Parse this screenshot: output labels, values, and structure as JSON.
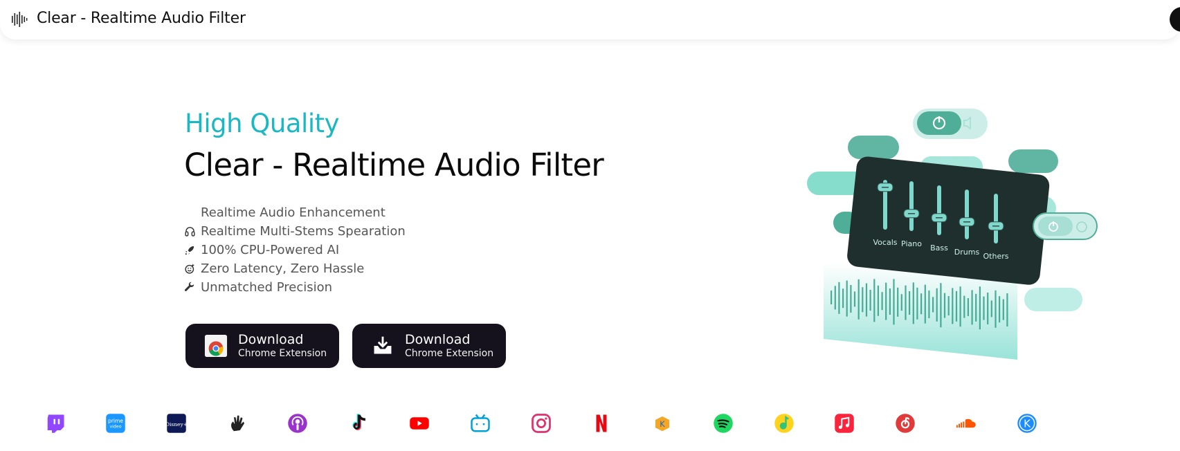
{
  "header": {
    "title": "Clear - Realtime Audio Filter",
    "logo_icon": "sound-bars-icon"
  },
  "hero": {
    "subtitle": "High Quality",
    "title": "Clear - Realtime Audio Filter",
    "accent_color": "#1bb8c3",
    "features": [
      {
        "icon": "sparkle-icon",
        "label": "Realtime Audio Enhancement"
      },
      {
        "icon": "headphones-icon",
        "label": "Realtime Multi-Stems Spearation"
      },
      {
        "icon": "rocket-icon",
        "label": "100% CPU-Powered AI"
      },
      {
        "icon": "smile-icon",
        "label": "Zero Latency, Zero Hassle"
      },
      {
        "icon": "wrench-icon",
        "label": "Unmatched Precision"
      }
    ],
    "buttons": [
      {
        "icon": "chrome-icon",
        "line1": "Download",
        "line2": "Chrome Extension"
      },
      {
        "icon": "download-icon",
        "line1": "Download",
        "line2": "Chrome Extension"
      }
    ]
  },
  "mixer": {
    "channels": [
      {
        "label": "Vocals",
        "level": 0.85
      },
      {
        "label": "Piano",
        "level": 0.35
      },
      {
        "label": "Bass",
        "level": 0.35
      },
      {
        "label": "Drums",
        "level": 0.35
      },
      {
        "label": "Others",
        "level": 0.35
      }
    ],
    "panel_color": "#1f2f2d",
    "accent": "#7fd8cb"
  },
  "platforms": [
    {
      "name": "twitch-icon",
      "color": "#9146ff"
    },
    {
      "name": "prime-video-icon",
      "color": "#1a98ff"
    },
    {
      "name": "disney-plus-icon",
      "color": "#0e1a55"
    },
    {
      "name": "hand-wave-icon",
      "color": "#222222"
    },
    {
      "name": "podcasts-icon",
      "color": "#9933cc"
    },
    {
      "name": "tiktok-icon",
      "color": "#111111"
    },
    {
      "name": "youtube-icon",
      "color": "#ff0000"
    },
    {
      "name": "bilibili-icon",
      "color": "#00a1d6"
    },
    {
      "name": "instagram-icon",
      "color": "#e1306c"
    },
    {
      "name": "netflix-icon",
      "color": "#e50914"
    },
    {
      "name": "kugou-icon",
      "color": "#f5a623"
    },
    {
      "name": "spotify-icon",
      "color": "#1ed760"
    },
    {
      "name": "qq-music-icon",
      "color": "#31c27c"
    },
    {
      "name": "apple-music-icon",
      "color": "#fa243c"
    },
    {
      "name": "netease-music-icon",
      "color": "#e03a3a"
    },
    {
      "name": "soundcloud-icon",
      "color": "#ff5500"
    },
    {
      "name": "kuwo-icon",
      "color": "#1a8cff"
    }
  ]
}
